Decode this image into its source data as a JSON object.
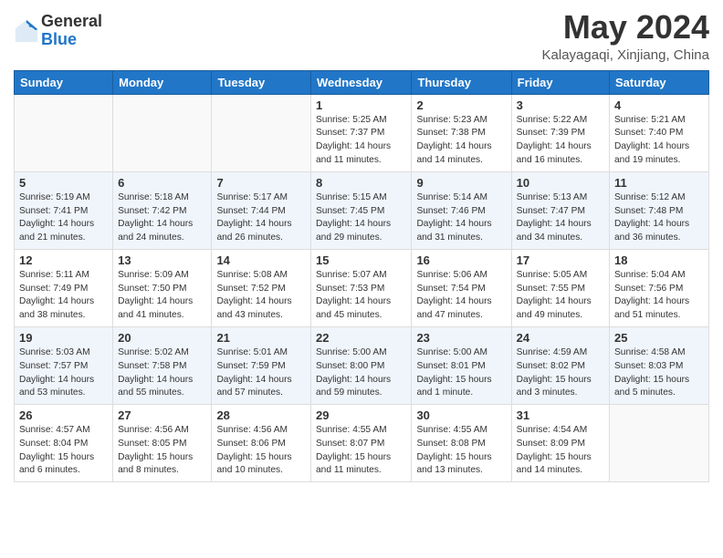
{
  "header": {
    "logo_general": "General",
    "logo_blue": "Blue",
    "month_year": "May 2024",
    "location": "Kalayagaqi, Xinjiang, China"
  },
  "weekdays": [
    "Sunday",
    "Monday",
    "Tuesday",
    "Wednesday",
    "Thursday",
    "Friday",
    "Saturday"
  ],
  "weeks": [
    [
      {
        "day": "",
        "sunrise": "",
        "sunset": "",
        "daylight": ""
      },
      {
        "day": "",
        "sunrise": "",
        "sunset": "",
        "daylight": ""
      },
      {
        "day": "",
        "sunrise": "",
        "sunset": "",
        "daylight": ""
      },
      {
        "day": "1",
        "sunrise": "Sunrise: 5:25 AM",
        "sunset": "Sunset: 7:37 PM",
        "daylight": "Daylight: 14 hours and 11 minutes."
      },
      {
        "day": "2",
        "sunrise": "Sunrise: 5:23 AM",
        "sunset": "Sunset: 7:38 PM",
        "daylight": "Daylight: 14 hours and 14 minutes."
      },
      {
        "day": "3",
        "sunrise": "Sunrise: 5:22 AM",
        "sunset": "Sunset: 7:39 PM",
        "daylight": "Daylight: 14 hours and 16 minutes."
      },
      {
        "day": "4",
        "sunrise": "Sunrise: 5:21 AM",
        "sunset": "Sunset: 7:40 PM",
        "daylight": "Daylight: 14 hours and 19 minutes."
      }
    ],
    [
      {
        "day": "5",
        "sunrise": "Sunrise: 5:19 AM",
        "sunset": "Sunset: 7:41 PM",
        "daylight": "Daylight: 14 hours and 21 minutes."
      },
      {
        "day": "6",
        "sunrise": "Sunrise: 5:18 AM",
        "sunset": "Sunset: 7:42 PM",
        "daylight": "Daylight: 14 hours and 24 minutes."
      },
      {
        "day": "7",
        "sunrise": "Sunrise: 5:17 AM",
        "sunset": "Sunset: 7:44 PM",
        "daylight": "Daylight: 14 hours and 26 minutes."
      },
      {
        "day": "8",
        "sunrise": "Sunrise: 5:15 AM",
        "sunset": "Sunset: 7:45 PM",
        "daylight": "Daylight: 14 hours and 29 minutes."
      },
      {
        "day": "9",
        "sunrise": "Sunrise: 5:14 AM",
        "sunset": "Sunset: 7:46 PM",
        "daylight": "Daylight: 14 hours and 31 minutes."
      },
      {
        "day": "10",
        "sunrise": "Sunrise: 5:13 AM",
        "sunset": "Sunset: 7:47 PM",
        "daylight": "Daylight: 14 hours and 34 minutes."
      },
      {
        "day": "11",
        "sunrise": "Sunrise: 5:12 AM",
        "sunset": "Sunset: 7:48 PM",
        "daylight": "Daylight: 14 hours and 36 minutes."
      }
    ],
    [
      {
        "day": "12",
        "sunrise": "Sunrise: 5:11 AM",
        "sunset": "Sunset: 7:49 PM",
        "daylight": "Daylight: 14 hours and 38 minutes."
      },
      {
        "day": "13",
        "sunrise": "Sunrise: 5:09 AM",
        "sunset": "Sunset: 7:50 PM",
        "daylight": "Daylight: 14 hours and 41 minutes."
      },
      {
        "day": "14",
        "sunrise": "Sunrise: 5:08 AM",
        "sunset": "Sunset: 7:52 PM",
        "daylight": "Daylight: 14 hours and 43 minutes."
      },
      {
        "day": "15",
        "sunrise": "Sunrise: 5:07 AM",
        "sunset": "Sunset: 7:53 PM",
        "daylight": "Daylight: 14 hours and 45 minutes."
      },
      {
        "day": "16",
        "sunrise": "Sunrise: 5:06 AM",
        "sunset": "Sunset: 7:54 PM",
        "daylight": "Daylight: 14 hours and 47 minutes."
      },
      {
        "day": "17",
        "sunrise": "Sunrise: 5:05 AM",
        "sunset": "Sunset: 7:55 PM",
        "daylight": "Daylight: 14 hours and 49 minutes."
      },
      {
        "day": "18",
        "sunrise": "Sunrise: 5:04 AM",
        "sunset": "Sunset: 7:56 PM",
        "daylight": "Daylight: 14 hours and 51 minutes."
      }
    ],
    [
      {
        "day": "19",
        "sunrise": "Sunrise: 5:03 AM",
        "sunset": "Sunset: 7:57 PM",
        "daylight": "Daylight: 14 hours and 53 minutes."
      },
      {
        "day": "20",
        "sunrise": "Sunrise: 5:02 AM",
        "sunset": "Sunset: 7:58 PM",
        "daylight": "Daylight: 14 hours and 55 minutes."
      },
      {
        "day": "21",
        "sunrise": "Sunrise: 5:01 AM",
        "sunset": "Sunset: 7:59 PM",
        "daylight": "Daylight: 14 hours and 57 minutes."
      },
      {
        "day": "22",
        "sunrise": "Sunrise: 5:00 AM",
        "sunset": "Sunset: 8:00 PM",
        "daylight": "Daylight: 14 hours and 59 minutes."
      },
      {
        "day": "23",
        "sunrise": "Sunrise: 5:00 AM",
        "sunset": "Sunset: 8:01 PM",
        "daylight": "Daylight: 15 hours and 1 minute."
      },
      {
        "day": "24",
        "sunrise": "Sunrise: 4:59 AM",
        "sunset": "Sunset: 8:02 PM",
        "daylight": "Daylight: 15 hours and 3 minutes."
      },
      {
        "day": "25",
        "sunrise": "Sunrise: 4:58 AM",
        "sunset": "Sunset: 8:03 PM",
        "daylight": "Daylight: 15 hours and 5 minutes."
      }
    ],
    [
      {
        "day": "26",
        "sunrise": "Sunrise: 4:57 AM",
        "sunset": "Sunset: 8:04 PM",
        "daylight": "Daylight: 15 hours and 6 minutes."
      },
      {
        "day": "27",
        "sunrise": "Sunrise: 4:56 AM",
        "sunset": "Sunset: 8:05 PM",
        "daylight": "Daylight: 15 hours and 8 minutes."
      },
      {
        "day": "28",
        "sunrise": "Sunrise: 4:56 AM",
        "sunset": "Sunset: 8:06 PM",
        "daylight": "Daylight: 15 hours and 10 minutes."
      },
      {
        "day": "29",
        "sunrise": "Sunrise: 4:55 AM",
        "sunset": "Sunset: 8:07 PM",
        "daylight": "Daylight: 15 hours and 11 minutes."
      },
      {
        "day": "30",
        "sunrise": "Sunrise: 4:55 AM",
        "sunset": "Sunset: 8:08 PM",
        "daylight": "Daylight: 15 hours and 13 minutes."
      },
      {
        "day": "31",
        "sunrise": "Sunrise: 4:54 AM",
        "sunset": "Sunset: 8:09 PM",
        "daylight": "Daylight: 15 hours and 14 minutes."
      },
      {
        "day": "",
        "sunrise": "",
        "sunset": "",
        "daylight": ""
      }
    ]
  ]
}
